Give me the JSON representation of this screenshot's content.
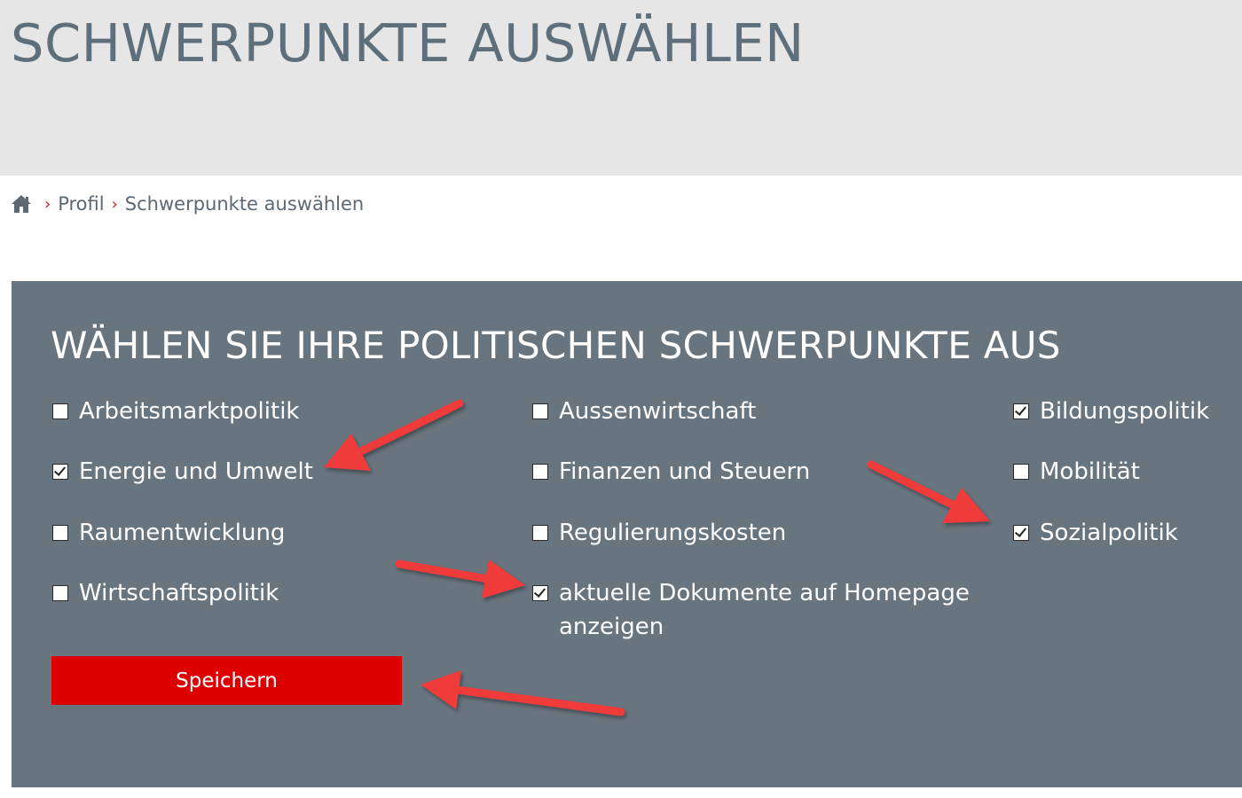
{
  "header": {
    "title": "SCHWERPUNKTE AUSWÄHLEN"
  },
  "breadcrumb": {
    "home_icon": "home-icon",
    "separator": "›",
    "items": [
      "Profil",
      "Schwerpunkte auswählen"
    ]
  },
  "panel": {
    "title": "WÄHLEN SIE IHRE POLITISCHEN SCHWERPUNKTE AUS",
    "options": [
      {
        "label": "Arbeitsmarktpolitik",
        "checked": false
      },
      {
        "label": "Energie und Umwelt",
        "checked": true
      },
      {
        "label": "Raumentwicklung",
        "checked": false
      },
      {
        "label": "Wirtschaftspolitik",
        "checked": false
      },
      {
        "label": "Aussenwirtschaft",
        "checked": false
      },
      {
        "label": "Finanzen und Steuern",
        "checked": false
      },
      {
        "label": "Regulierungskosten",
        "checked": false
      },
      {
        "label": "aktuelle Dokumente auf Homepage anzeigen",
        "checked": true
      },
      {
        "label": "Bildungspolitik",
        "checked": true
      },
      {
        "label": "Mobilität",
        "checked": false
      },
      {
        "label": "Sozialpolitik",
        "checked": true
      }
    ],
    "save_label": "Speichern"
  },
  "colors": {
    "header_bg": "#e6e6e6",
    "title_color": "#5e6f7c",
    "panel_bg": "#68747e",
    "save_button": "#dd0000",
    "annotation_arrow": "#f03a3a"
  }
}
